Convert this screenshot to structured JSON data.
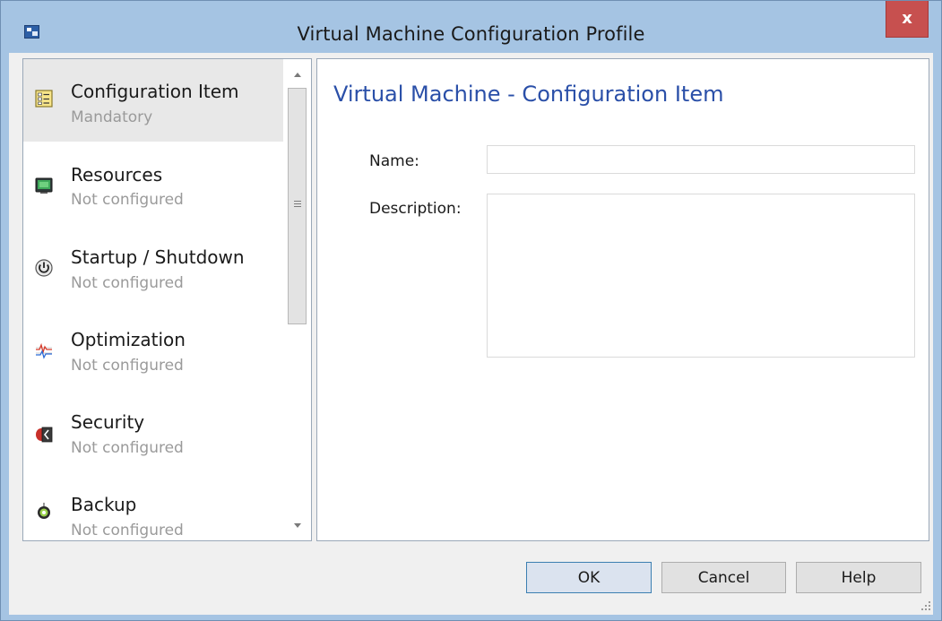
{
  "window": {
    "title": "Virtual Machine Configuration Profile",
    "close_glyph": "x"
  },
  "nav": {
    "items": [
      {
        "title": "Configuration Item",
        "status": "Mandatory",
        "icon": "configuration-item-icon",
        "selected": true
      },
      {
        "title": "Resources",
        "status": "Not configured",
        "icon": "resources-monitor-icon"
      },
      {
        "title": "Startup / Shutdown",
        "status": "Not configured",
        "icon": "power-icon"
      },
      {
        "title": "Optimization",
        "status": "Not configured",
        "icon": "optimization-chart-icon"
      },
      {
        "title": "Security",
        "status": "Not configured",
        "icon": "security-icon"
      },
      {
        "title": "Backup",
        "status": "Not configured",
        "icon": "backup-icon"
      }
    ],
    "scroll_thumb_glyph": "≡"
  },
  "content": {
    "header": "Virtual Machine - Configuration Item",
    "name_label": "Name:",
    "name_value": "",
    "description_label": "Description:",
    "description_value": ""
  },
  "buttons": {
    "ok": "OK",
    "cancel": "Cancel",
    "help": "Help"
  },
  "colors": {
    "title_bar": "#a5c4e3",
    "close_button": "#c7504f",
    "header_text": "#2a4fa8",
    "status_text": "#9a9a9a"
  }
}
